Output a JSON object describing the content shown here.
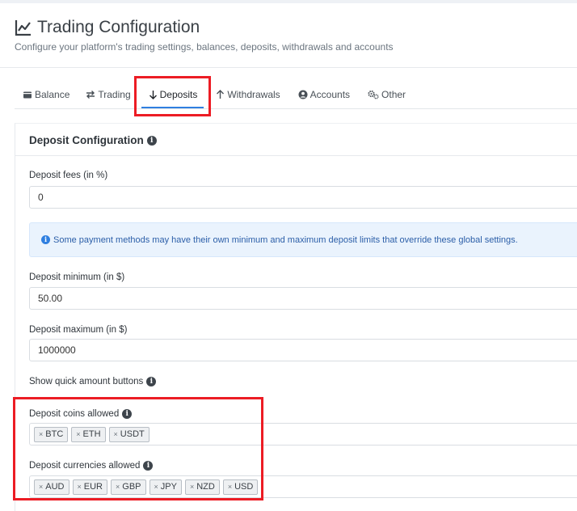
{
  "header": {
    "title": "Trading Configuration",
    "subtitle": "Configure your platform's trading settings, balances, deposits, withdrawals and accounts"
  },
  "tabs": [
    {
      "label": "Balance",
      "icon": "wallet-icon"
    },
    {
      "label": "Trading",
      "icon": "exchange-arrows-icon"
    },
    {
      "label": "Deposits",
      "icon": "arrow-down-icon",
      "active": true
    },
    {
      "label": "Withdrawals",
      "icon": "arrow-up-icon"
    },
    {
      "label": "Accounts",
      "icon": "user-circle-icon"
    },
    {
      "label": "Other",
      "icon": "gears-icon"
    }
  ],
  "card": {
    "title": "Deposit Configuration",
    "fees_label": "Deposit fees (in %)",
    "fees_value": "0",
    "alert": "Some payment methods may have their own minimum and maximum deposit limits that override these global settings.",
    "min_label": "Deposit minimum (in $)",
    "min_value": "50.00",
    "max_label": "Deposit maximum (in $)",
    "max_value": "1000000",
    "quick_label": "Show quick amount buttons",
    "coins_label": "Deposit coins allowed",
    "coins": [
      "BTC",
      "ETH",
      "USDT"
    ],
    "currencies_label": "Deposit currencies allowed",
    "currencies": [
      "AUD",
      "EUR",
      "GBP",
      "JPY",
      "NZD",
      "USD"
    ]
  },
  "colors": {
    "accent": "#2f7fe0",
    "highlight": "#ec1c24",
    "alert_bg": "#eaf3fd"
  }
}
